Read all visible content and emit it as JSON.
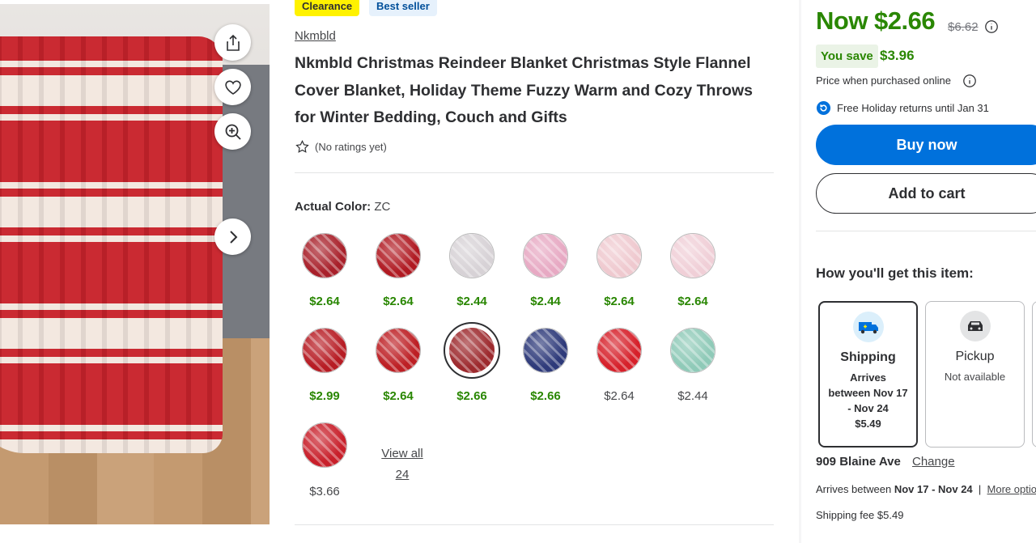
{
  "badges": {
    "clearance": "Clearance",
    "best_seller": "Best seller"
  },
  "product": {
    "brand": "Nkmbld",
    "title": "Nkmbld Christmas Reindeer Blanket Christmas Style Flannel Cover Blanket, Holiday Theme Fuzzy Warm and Cozy Throws for Winter Bedding, Couch and Gifts",
    "rating_text": "(No ratings yet)"
  },
  "color": {
    "label": "Actual Color:",
    "value": "ZC"
  },
  "variants": [
    {
      "price": "$2.64",
      "in_stock": true,
      "selected": false,
      "swatch_color": "#a8202a"
    },
    {
      "price": "$2.64",
      "in_stock": true,
      "selected": false,
      "swatch_color": "#b01a22"
    },
    {
      "price": "$2.44",
      "in_stock": true,
      "selected": false,
      "swatch_color": "#d7d2d6"
    },
    {
      "price": "$2.44",
      "in_stock": true,
      "selected": false,
      "swatch_color": "#e7a9c3"
    },
    {
      "price": "$2.64",
      "in_stock": true,
      "selected": false,
      "swatch_color": "#efc9cf"
    },
    {
      "price": "$2.64",
      "in_stock": true,
      "selected": false,
      "swatch_color": "#f0cfd7"
    },
    {
      "price": "$2.99",
      "in_stock": true,
      "selected": false,
      "swatch_color": "#b71c24"
    },
    {
      "price": "$2.64",
      "in_stock": true,
      "selected": false,
      "swatch_color": "#bd1f24"
    },
    {
      "price": "$2.66",
      "in_stock": true,
      "selected": true,
      "swatch_color": "#9d2a2e"
    },
    {
      "price": "$2.66",
      "in_stock": true,
      "selected": false,
      "swatch_color": "#2e3a7a"
    },
    {
      "price": "$2.64",
      "in_stock": false,
      "selected": false,
      "swatch_color": "#d6202a"
    },
    {
      "price": "$2.44",
      "in_stock": false,
      "selected": false,
      "swatch_color": "#8fcab8"
    },
    {
      "price": "$3.66",
      "in_stock": false,
      "selected": false,
      "swatch_color": "#c81f2a"
    }
  ],
  "view_all": {
    "line1": "View all",
    "line2": "24"
  },
  "pricing": {
    "now": "Now $2.66",
    "was": "$6.62",
    "you_save_label": "You save",
    "you_save_amount": "$3.96",
    "online_note": "Price when purchased online",
    "returns": "Free Holiday returns until Jan 31"
  },
  "actions": {
    "buy_now": "Buy now",
    "add_to_cart": "Add to cart"
  },
  "fulfillment": {
    "heading": "How you'll get this item:",
    "shipping": {
      "name": "Shipping",
      "line1": "Arrives",
      "line2": "between Nov 17",
      "line3": "- Nov 24",
      "price": "$5.49"
    },
    "pickup": {
      "name": "Pickup",
      "status": "Not available"
    },
    "address": "909 Blaine Ave",
    "change": "Change",
    "arrives_prefix": "Arrives between",
    "arrives_dates": "Nov 17 - Nov 24",
    "more_options": "More options",
    "shipping_fee": "Shipping fee $5.49"
  },
  "colors": {
    "accent_green": "#2a8703",
    "primary_blue": "#0071dc",
    "badge_yellow": "#fff200"
  }
}
